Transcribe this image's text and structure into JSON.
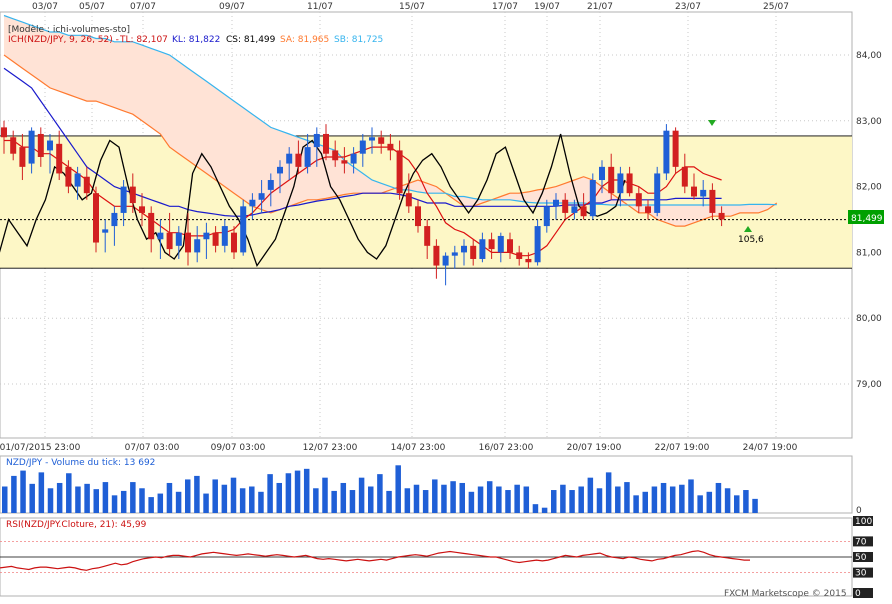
{
  "top_dates": [
    "03/07",
    "05/07",
    "07/07",
    "09/07",
    "11/07",
    "15/07",
    "17/07",
    "19/07",
    "21/07",
    "23/07",
    "25/07"
  ],
  "bottom_dates": [
    "01/07/2015 23:00",
    "07/07 03:00",
    "09/07 03:00",
    "12/07 23:00",
    "14/07 23:00",
    "16/07 23:00",
    "20/07 19:00",
    "22/07 19:00",
    "24/07 19:00"
  ],
  "main_legend": {
    "model": "[Modèle : ichi-volumes-sto]",
    "ich": "ICH(NZD/JPY, 9, 26, 52) -",
    "tl": "TL: 82,107",
    "kl": "KL: 81,822",
    "cs": "CS: 81,499",
    "sa": "SA: 81,965",
    "sb": "SB: 81,725"
  },
  "volume_title": "NZD/JPY - Volume du tick: 13 692",
  "rsi_title": "RSI(NZD/JPY.Cloture, 21): 45,99",
  "copyright": "FXCM Marketscope © 2015",
  "price_annotation": "105,6",
  "current_price_label": "81,499",
  "colors": {
    "bull": "#1f5fd6",
    "bear": "#d22020",
    "tenkan": "#dd1111",
    "kijun": "#1a1acc",
    "chikou": "#000000",
    "senkou_a": "#ff7a30",
    "senkou_b": "#36b4ee",
    "cloud": "#ffe3d6",
    "band": "#fdf7c6",
    "volume": "#1f5fd6",
    "rsi": "#cc1111",
    "price_box": "#00a000"
  },
  "chart_data": [
    {
      "type": "candlestick",
      "title": "NZD/JPY",
      "y_axis_ticks": [
        "84,00",
        "83,00",
        "82,00",
        "81,00",
        "80,00",
        "79,00"
      ],
      "ylim": [
        78.5,
        84.6
      ],
      "horizontal_levels": [
        82.77,
        80.76
      ],
      "current_price": 81.499,
      "ohlc": [
        [
          82.9,
          83.0,
          82.5,
          82.75
        ],
        [
          82.75,
          82.85,
          82.4,
          82.5
        ],
        [
          82.6,
          82.8,
          82.1,
          82.3
        ],
        [
          82.35,
          82.9,
          82.2,
          82.85
        ],
        [
          82.8,
          82.9,
          82.3,
          82.45
        ],
        [
          82.55,
          82.8,
          82.2,
          82.7
        ],
        [
          82.65,
          82.85,
          82.1,
          82.2
        ],
        [
          82.3,
          82.4,
          81.9,
          82.0
        ],
        [
          82.0,
          82.3,
          81.8,
          82.2
        ],
        [
          82.15,
          82.3,
          81.8,
          81.9
        ],
        [
          81.9,
          82.0,
          81.0,
          81.15
        ],
        [
          81.3,
          81.5,
          81.0,
          81.35
        ],
        [
          81.4,
          81.7,
          81.1,
          81.6
        ],
        [
          81.6,
          82.1,
          81.4,
          82.0
        ],
        [
          82.0,
          82.2,
          81.6,
          81.75
        ],
        [
          81.7,
          81.9,
          81.4,
          81.6
        ],
        [
          81.6,
          81.7,
          81.0,
          81.2
        ],
        [
          81.2,
          81.5,
          80.9,
          81.3
        ],
        [
          81.3,
          81.6,
          80.95,
          81.05
        ],
        [
          81.1,
          81.4,
          80.9,
          81.3
        ],
        [
          81.3,
          81.6,
          80.8,
          81.0
        ],
        [
          81.0,
          81.4,
          80.85,
          81.2
        ],
        [
          81.2,
          81.45,
          80.9,
          81.3
        ],
        [
          81.3,
          81.4,
          81.0,
          81.1
        ],
        [
          81.1,
          81.5,
          81.0,
          81.4
        ],
        [
          81.3,
          81.4,
          80.9,
          81.0
        ],
        [
          81.0,
          81.8,
          80.95,
          81.7
        ],
        [
          81.7,
          81.9,
          81.5,
          81.8
        ],
        [
          81.8,
          82.1,
          81.6,
          81.9
        ],
        [
          81.95,
          82.2,
          81.7,
          82.1
        ],
        [
          82.2,
          82.4,
          81.9,
          82.3
        ],
        [
          82.35,
          82.6,
          82.1,
          82.5
        ],
        [
          82.5,
          82.7,
          82.2,
          82.3
        ],
        [
          82.3,
          82.8,
          82.2,
          82.6
        ],
        [
          82.6,
          82.9,
          82.3,
          82.8
        ],
        [
          82.8,
          82.95,
          82.4,
          82.5
        ],
        [
          82.55,
          82.7,
          82.3,
          82.4
        ],
        [
          82.4,
          82.6,
          82.2,
          82.35
        ],
        [
          82.35,
          82.6,
          82.2,
          82.5
        ],
        [
          82.5,
          82.8,
          82.3,
          82.7
        ],
        [
          82.7,
          82.9,
          82.5,
          82.75
        ],
        [
          82.75,
          82.85,
          82.5,
          82.65
        ],
        [
          82.65,
          82.8,
          82.4,
          82.55
        ],
        [
          82.55,
          82.7,
          81.8,
          81.9
        ],
        [
          81.9,
          82.2,
          81.6,
          81.7
        ],
        [
          81.7,
          81.8,
          81.3,
          81.4
        ],
        [
          81.4,
          81.5,
          80.9,
          81.1
        ],
        [
          81.1,
          81.2,
          80.6,
          80.8
        ],
        [
          80.8,
          81.0,
          80.5,
          80.95
        ],
        [
          80.95,
          81.1,
          80.75,
          81.0
        ],
        [
          81.0,
          81.2,
          80.8,
          81.1
        ],
        [
          81.1,
          81.2,
          80.8,
          80.9
        ],
        [
          80.9,
          81.3,
          80.85,
          81.2
        ],
        [
          81.2,
          81.3,
          80.9,
          81.05
        ],
        [
          81.0,
          81.3,
          80.85,
          81.25
        ],
        [
          81.2,
          81.3,
          80.9,
          81.0
        ],
        [
          81.0,
          81.1,
          80.8,
          80.9
        ],
        [
          80.9,
          81.0,
          80.75,
          80.85
        ],
        [
          80.85,
          81.5,
          80.8,
          81.4
        ],
        [
          81.4,
          81.8,
          81.3,
          81.7
        ],
        [
          81.7,
          81.9,
          81.5,
          81.8
        ],
        [
          81.8,
          81.9,
          81.5,
          81.6
        ],
        [
          81.6,
          81.8,
          81.5,
          81.7
        ],
        [
          81.7,
          81.9,
          81.5,
          81.55
        ],
        [
          81.55,
          82.2,
          81.5,
          82.1
        ],
        [
          82.1,
          82.4,
          81.9,
          82.3
        ],
        [
          82.3,
          82.5,
          81.8,
          81.9
        ],
        [
          81.9,
          82.3,
          81.7,
          82.2
        ],
        [
          82.2,
          82.3,
          81.85,
          81.9
        ],
        [
          81.9,
          82.0,
          81.6,
          81.7
        ],
        [
          81.7,
          81.8,
          81.5,
          81.6
        ],
        [
          81.6,
          82.3,
          81.55,
          82.2
        ],
        [
          82.2,
          82.95,
          82.1,
          82.85
        ],
        [
          82.85,
          82.9,
          82.2,
          82.3
        ],
        [
          82.3,
          82.5,
          81.9,
          82.0
        ],
        [
          82.0,
          82.2,
          81.8,
          81.85
        ],
        [
          81.85,
          82.1,
          81.7,
          81.95
        ],
        [
          81.95,
          82.05,
          81.5,
          81.6
        ],
        [
          81.6,
          81.7,
          81.4,
          81.5
        ]
      ],
      "tenkan": [
        82.7,
        82.7,
        82.6,
        82.6,
        82.5,
        82.5,
        82.4,
        82.3,
        82.2,
        82.1,
        81.9,
        81.8,
        81.7,
        81.7,
        81.7,
        81.6,
        81.5,
        81.4,
        81.3,
        81.3,
        81.25,
        81.25,
        81.25,
        81.3,
        81.3,
        81.35,
        81.5,
        81.6,
        81.75,
        81.9,
        82.0,
        82.1,
        82.2,
        82.3,
        82.4,
        82.45,
        82.45,
        82.45,
        82.5,
        82.55,
        82.6,
        82.6,
        82.6,
        82.5,
        82.4,
        82.2,
        81.9,
        81.7,
        81.45,
        81.35,
        81.3,
        81.2,
        81.1,
        81.0,
        81.0,
        81.0,
        80.95,
        80.95,
        81.0,
        81.1,
        81.3,
        81.5,
        81.6,
        81.7,
        81.8,
        82.0,
        82.1,
        82.1,
        82.05,
        82.0,
        81.9,
        81.9,
        82.0,
        82.2,
        82.3,
        82.3,
        82.2,
        82.15,
        82.1
      ],
      "kijun": [
        83.8,
        83.7,
        83.6,
        83.5,
        83.3,
        83.1,
        82.9,
        82.7,
        82.5,
        82.3,
        82.2,
        82.1,
        82.0,
        81.95,
        81.9,
        81.85,
        81.8,
        81.75,
        81.7,
        81.7,
        81.65,
        81.62,
        81.6,
        81.58,
        81.56,
        81.55,
        81.55,
        81.57,
        81.6,
        81.62,
        81.65,
        81.7,
        81.72,
        81.75,
        81.78,
        81.8,
        81.82,
        81.85,
        81.87,
        81.9,
        81.9,
        81.9,
        81.9,
        81.88,
        81.85,
        81.8,
        81.75,
        81.75,
        81.75,
        81.7,
        81.7,
        81.7,
        81.7,
        81.7,
        81.7,
        81.7,
        81.7,
        81.7,
        81.7,
        81.7,
        81.7,
        81.72,
        81.72,
        81.72,
        81.75,
        81.75,
        81.8,
        81.8,
        81.8,
        81.8,
        81.8,
        81.8,
        81.8,
        81.82,
        81.82,
        81.82,
        81.82,
        81.82,
        81.82
      ],
      "chikou": [
        81.0,
        81.5,
        81.3,
        81.1,
        81.5,
        81.8,
        82.3,
        82.2,
        82.0,
        81.8,
        81.9,
        82.4,
        82.7,
        82.6,
        82.0,
        81.5,
        81.2,
        81.3,
        81.0,
        80.9,
        81.1,
        82.2,
        82.5,
        82.3,
        82.0,
        81.7,
        81.5,
        81.2,
        80.8,
        81.0,
        81.2,
        81.6,
        82.0,
        82.6,
        82.7,
        82.5,
        82.0,
        81.8,
        81.5,
        81.2,
        81.0,
        80.9,
        81.1,
        81.5,
        81.9,
        82.2,
        82.4,
        82.5,
        82.3,
        82.0,
        81.8,
        81.6,
        81.8,
        82.1,
        82.5,
        82.6,
        82.2,
        81.8,
        81.6,
        81.9,
        82.3,
        82.8,
        82.2,
        81.7,
        81.6,
        81.55,
        81.6,
        81.7,
        82.1
      ],
      "senkou_a": [
        84.0,
        83.9,
        83.8,
        83.7,
        83.6,
        83.5,
        83.45,
        83.4,
        83.35,
        83.3,
        83.3,
        83.25,
        83.2,
        83.15,
        83.1,
        83.0,
        82.9,
        82.8,
        82.6,
        82.5,
        82.4,
        82.3,
        82.2,
        82.1,
        82.0,
        81.9,
        81.8,
        81.7,
        81.65,
        81.6,
        81.65,
        81.7,
        81.75,
        81.8,
        81.8,
        81.82,
        81.85,
        81.88,
        81.9,
        81.9,
        81.9,
        81.9,
        81.95,
        82.0,
        82.05,
        82.1,
        82.05,
        82.0,
        81.9,
        81.8,
        81.7,
        81.7,
        81.75,
        81.8,
        81.85,
        81.9,
        81.9,
        81.92,
        81.95,
        81.97,
        82.0,
        82.05,
        82.1,
        82.15,
        82.1,
        82.0,
        81.9,
        81.8,
        81.7,
        81.6,
        81.6,
        81.5,
        81.45,
        81.4,
        81.4,
        81.45,
        81.5,
        81.55,
        81.55,
        81.55,
        81.6,
        81.6,
        81.6,
        81.65,
        81.75
      ],
      "senkou_b": [
        84.6,
        84.55,
        84.5,
        84.45,
        84.4,
        84.35,
        84.35,
        84.3,
        84.3,
        84.3,
        84.25,
        84.25,
        84.2,
        84.2,
        84.2,
        84.15,
        84.1,
        84.05,
        84.0,
        83.9,
        83.8,
        83.7,
        83.6,
        83.5,
        83.4,
        83.3,
        83.2,
        83.1,
        83.0,
        82.9,
        82.85,
        82.8,
        82.75,
        82.7,
        82.65,
        82.6,
        82.55,
        82.4,
        82.3,
        82.2,
        82.1,
        82.05,
        82.0,
        81.95,
        81.95,
        81.92,
        81.9,
        81.9,
        81.9,
        81.85,
        81.85,
        81.82,
        81.8,
        81.8,
        81.8,
        81.8,
        81.78,
        81.76,
        81.75,
        81.75,
        81.75,
        81.75,
        81.75,
        81.75,
        81.73,
        81.73,
        81.72,
        81.72,
        81.72,
        81.72,
        81.72,
        81.72,
        81.72,
        81.72,
        81.72,
        81.72,
        81.72,
        81.72,
        81.72,
        81.72,
        81.72,
        81.73,
        81.73,
        81.73,
        81.725
      ]
    },
    {
      "type": "bar",
      "title": "NZD/JPY - Volume du tick",
      "y_axis_ticks": [
        "0"
      ],
      "values": [
        30,
        42,
        48,
        33,
        46,
        28,
        34,
        45,
        30,
        33,
        27,
        35,
        20,
        25,
        35,
        28,
        18,
        22,
        34,
        24,
        38,
        42,
        22,
        38,
        32,
        40,
        28,
        30,
        24,
        44,
        34,
        45,
        48,
        50,
        28,
        40,
        25,
        34,
        26,
        40,
        30,
        44,
        25,
        54,
        28,
        32,
        26,
        38,
        32,
        36,
        34,
        24,
        30,
        36,
        30,
        26,
        32,
        30,
        10,
        6,
        26,
        32,
        26,
        30,
        40,
        28,
        46,
        30,
        35,
        20,
        24,
        30,
        34,
        30,
        32,
        38,
        20,
        24,
        34,
        28,
        20,
        26,
        16
      ],
      "ylim": [
        0,
        60
      ]
    },
    {
      "type": "line",
      "title": "RSI(NZD/JPY.Cloture, 21)",
      "y_axis_ticks": [
        "100",
        "70",
        "50",
        "30",
        "0"
      ],
      "ylim": [
        0,
        100
      ],
      "reference_levels": [
        70,
        50,
        30
      ],
      "values": [
        36,
        37,
        38,
        36,
        35,
        34,
        36,
        37,
        37,
        36,
        35,
        36,
        37,
        36,
        34,
        33,
        35,
        36,
        38,
        40,
        42,
        40,
        41,
        44,
        46,
        48,
        49,
        50,
        49,
        51,
        52,
        52,
        51,
        50,
        52,
        54,
        55,
        56,
        55,
        54,
        53,
        52,
        53,
        54,
        53,
        52,
        51,
        52,
        53,
        52,
        51,
        50,
        51,
        52,
        50,
        48,
        47,
        48,
        47,
        46,
        45,
        46,
        47,
        46,
        45,
        46,
        47,
        46,
        48,
        50,
        51,
        52,
        53,
        52,
        51,
        53,
        55,
        56,
        57,
        56,
        55,
        54,
        53,
        52,
        51,
        50,
        50,
        48,
        46,
        44,
        43,
        44,
        45,
        46,
        45,
        46,
        48,
        50,
        52,
        51,
        50,
        52,
        53,
        54,
        55,
        52,
        50,
        49,
        48,
        50,
        49,
        47,
        46,
        45,
        47,
        48,
        50,
        52,
        53,
        55,
        57,
        58,
        56,
        53,
        51,
        50,
        49,
        48,
        47,
        46,
        46
      ]
    }
  ]
}
